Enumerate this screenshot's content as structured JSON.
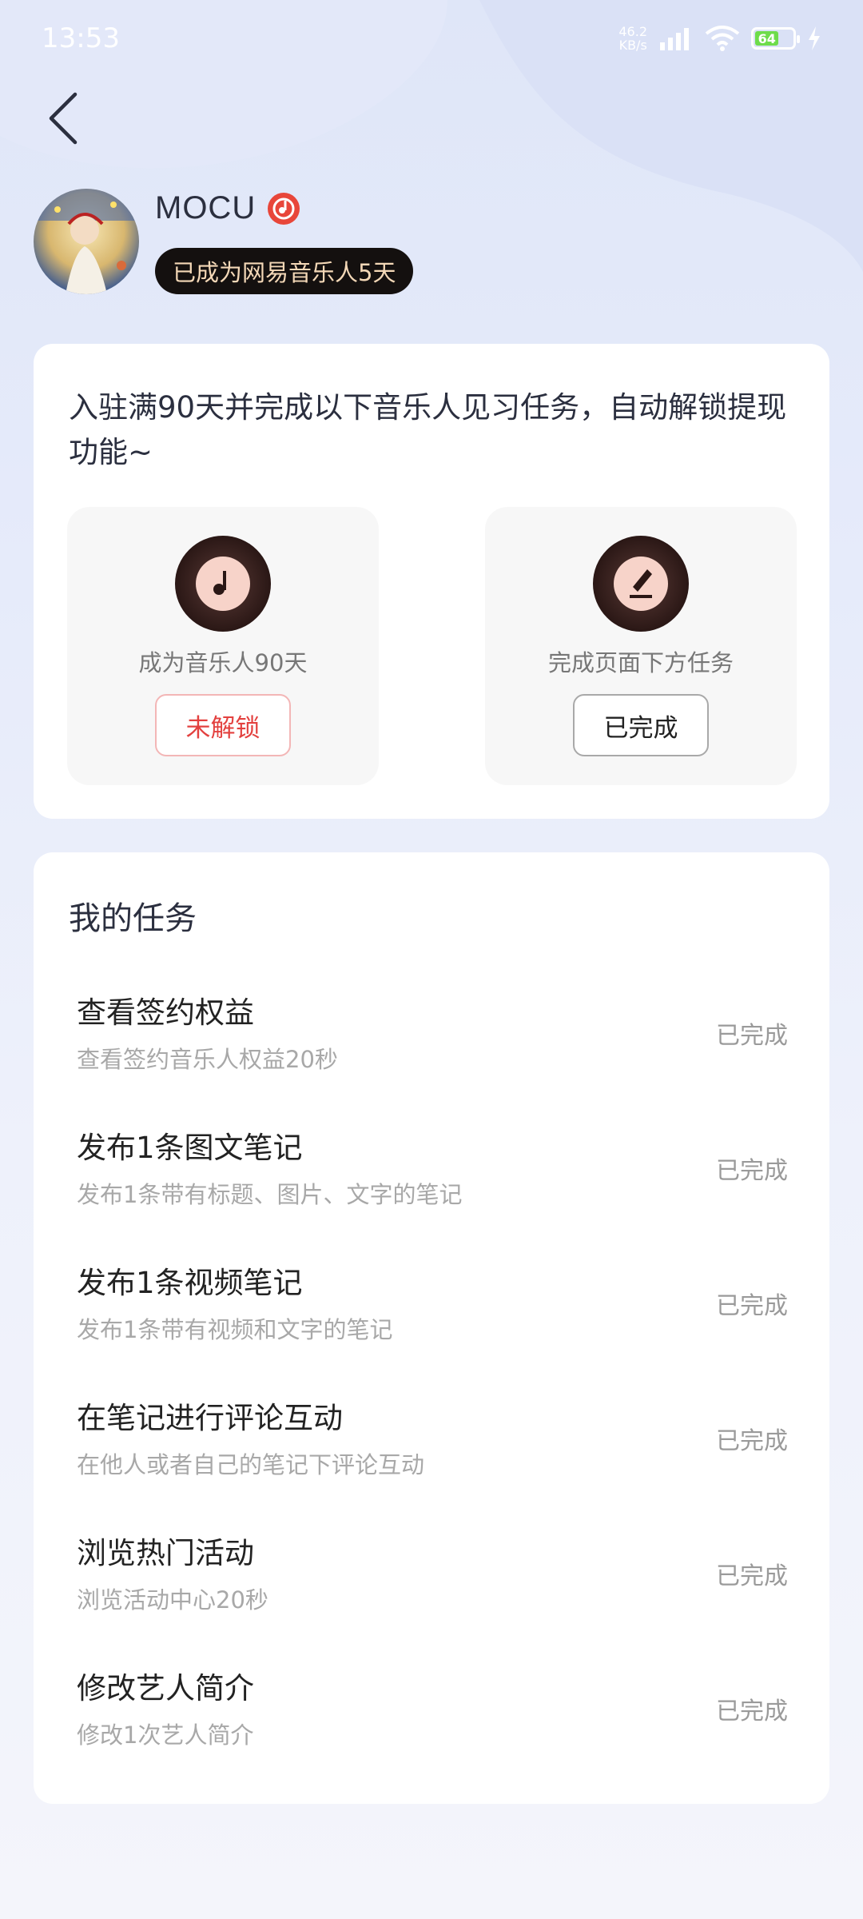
{
  "status_bar": {
    "time": "13:53",
    "net_speed_value": "46.2",
    "net_speed_unit": "KB/s",
    "battery": "64"
  },
  "profile": {
    "name": "MOCU",
    "days_badge": "已成为网易音乐人5天"
  },
  "unlock": {
    "intro": "入驻满90天并完成以下音乐人见习任务，自动解锁提现功能~",
    "items": [
      {
        "icon": "music-note-disc-icon",
        "label": "成为音乐人90天",
        "button": "未解锁"
      },
      {
        "icon": "pencil-disc-icon",
        "label": "完成页面下方任务",
        "button": "已完成"
      }
    ]
  },
  "tasks": {
    "title": "我的任务",
    "items": [
      {
        "title": "查看签约权益",
        "subtitle": "查看签约音乐人权益20秒",
        "status": "已完成"
      },
      {
        "title": "发布1条图文笔记",
        "subtitle": "发布1条带有标题、图片、文字的笔记",
        "status": "已完成"
      },
      {
        "title": "发布1条视频笔记",
        "subtitle": "发布1条带有视频和文字的笔记",
        "status": "已完成"
      },
      {
        "title": "在笔记进行评论互动",
        "subtitle": "在他人或者自己的笔记下评论互动",
        "status": "已完成"
      },
      {
        "title": "浏览热门活动",
        "subtitle": "浏览活动中心20秒",
        "status": "已完成"
      },
      {
        "title": "修改艺人简介",
        "subtitle": "修改1次艺人简介",
        "status": "已完成"
      }
    ]
  },
  "colors": {
    "accent_red": "#e3413f",
    "badge_bg": "#14100f",
    "badge_text": "#f4d8b7"
  }
}
